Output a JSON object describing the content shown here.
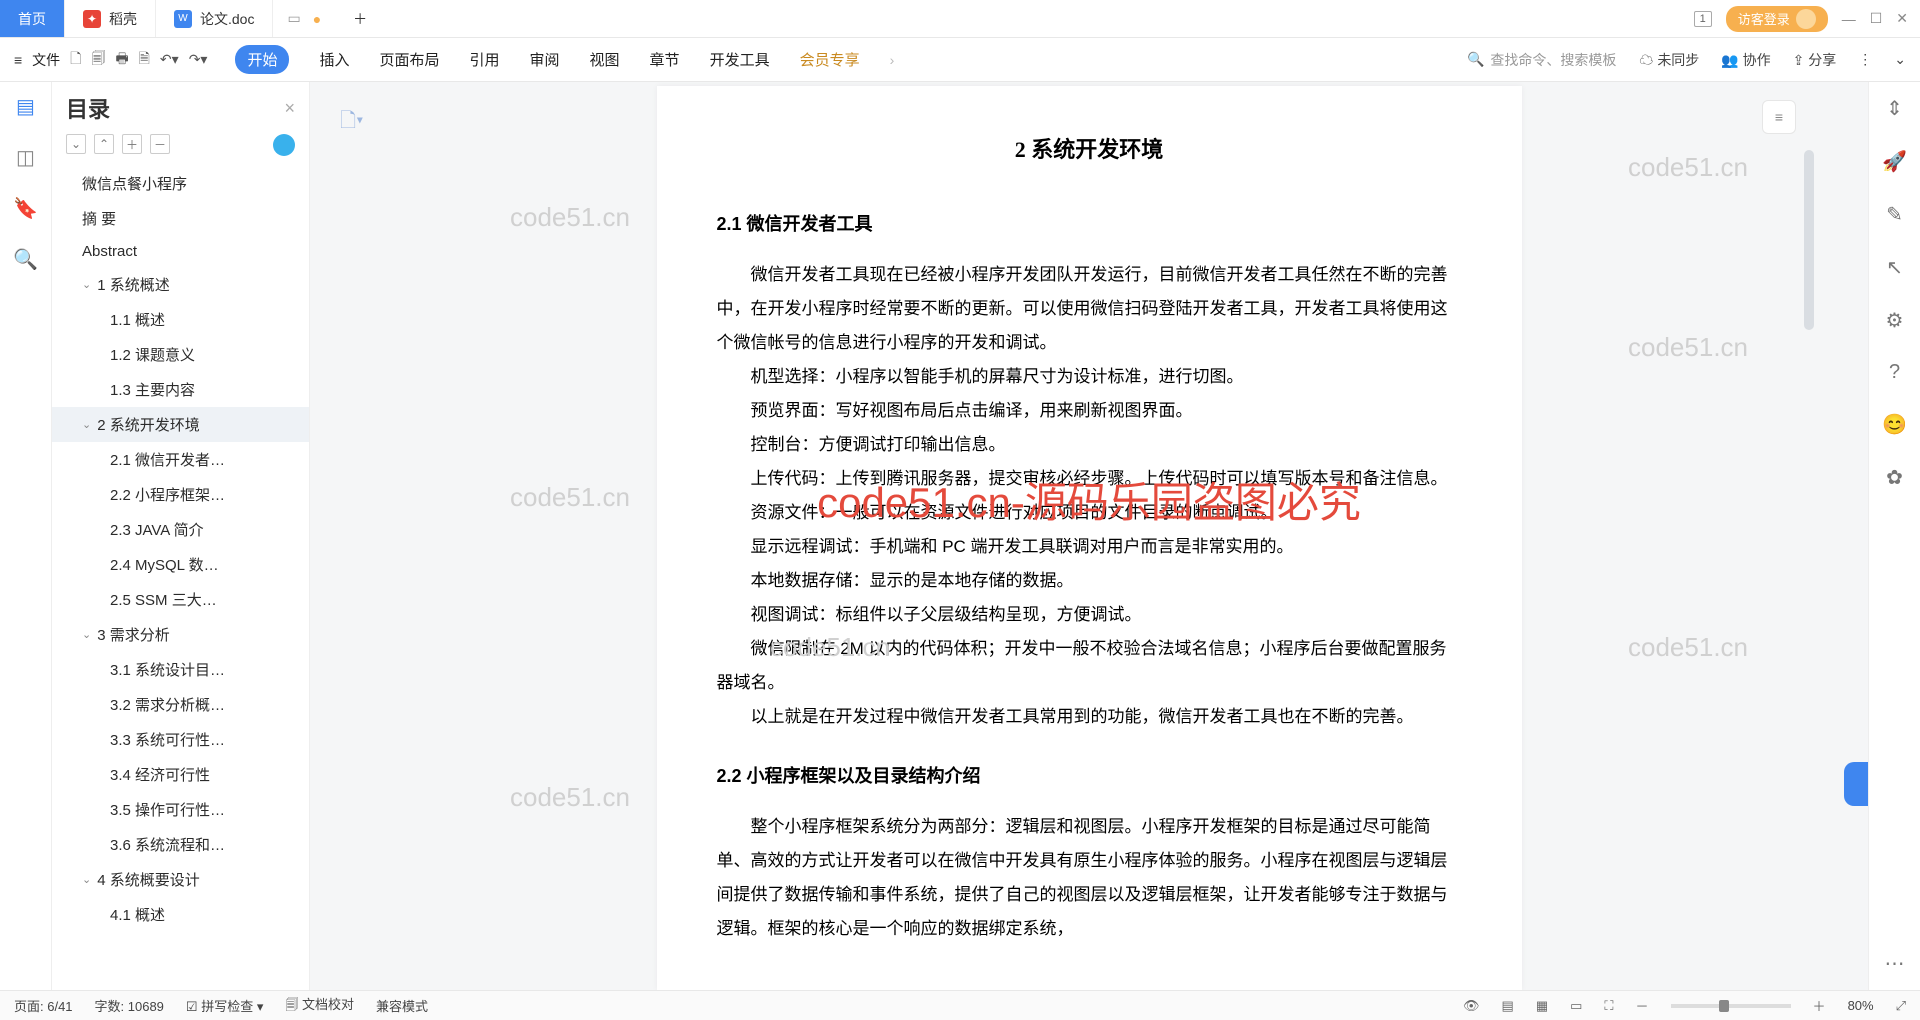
{
  "titlebar": {
    "home": "首页",
    "daoke": "稻壳",
    "doc": "论文.doc",
    "badge": "1",
    "login": "访客登录"
  },
  "ribbon": {
    "menu": "文件",
    "tabs": [
      "开始",
      "插入",
      "页面布局",
      "引用",
      "审阅",
      "视图",
      "章节",
      "开发工具",
      "会员专享"
    ],
    "search_placeholder": "查找命令、搜索模板",
    "sync": "未同步",
    "coop": "协作",
    "share": "分享"
  },
  "toc": {
    "title": "目录",
    "items": [
      {
        "t": "微信点餐小程序",
        "lv": 0
      },
      {
        "t": "摘 要",
        "lv": 0
      },
      {
        "t": "Abstract",
        "lv": 0
      },
      {
        "t": "1 系统概述",
        "lv": 1,
        "caret": true
      },
      {
        "t": "1.1 概述",
        "lv": 2
      },
      {
        "t": "1.2 课题意义",
        "lv": 2
      },
      {
        "t": "1.3 主要内容",
        "lv": 2
      },
      {
        "t": "2 系统开发环境",
        "lv": 1,
        "caret": true,
        "sel": true
      },
      {
        "t": "2.1 微信开发者…",
        "lv": 2
      },
      {
        "t": "2.2 小程序框架…",
        "lv": 2
      },
      {
        "t": "2.3 JAVA 简介",
        "lv": 2
      },
      {
        "t": "2.4 MySQL 数…",
        "lv": 2
      },
      {
        "t": "2.5 SSM 三大…",
        "lv": 2
      },
      {
        "t": "3 需求分析",
        "lv": 1,
        "caret": true
      },
      {
        "t": "3.1 系统设计目…",
        "lv": 2
      },
      {
        "t": "3.2 需求分析概…",
        "lv": 2
      },
      {
        "t": "3.3 系统可行性…",
        "lv": 2
      },
      {
        "t": "3.4 经济可行性",
        "lv": 2
      },
      {
        "t": "3.5 操作可行性…",
        "lv": 2
      },
      {
        "t": "3.6 系统流程和…",
        "lv": 2
      },
      {
        "t": "4 系统概要设计",
        "lv": 1,
        "caret": true
      },
      {
        "t": "4.1 概述",
        "lv": 2
      }
    ]
  },
  "doc": {
    "h1": "2  系统开发环境",
    "h21": "2.1 微信开发者工具",
    "p1": "微信开发者工具现在已经被小程序开发团队开发运行，目前微信开发者工具任然在不断的完善中，在开发小程序时经常要不断的更新。可以使用微信扫码登陆开发者工具，开发者工具将使用这个微信帐号的信息进行小程序的开发和调试。",
    "p2": "机型选择：小程序以智能手机的屏幕尺寸为设计标准，进行切图。",
    "p3": "预览界面：写好视图布局后点击编译，用来刷新视图界面。",
    "p4": "控制台：方便调试打印输出信息。",
    "p5": "上传代码：上传到腾讯服务器，提交审核必经步骤。上传代码时可以填写版本号和备注信息。",
    "p6": "资源文件：一般可以在资源文件进行对应项目的文件目录的断点调试。",
    "p7": "显示远程调试：手机端和 PC 端开发工具联调对用户而言是非常实用的。",
    "p8": "本地数据存储：显示的是本地存储的数据。",
    "p9": "视图调试：标组件以子父层级结构呈现，方便调试。",
    "p10": "微信限制在 2M 以内的代码体积；开发中一般不校验合法域名信息；小程序后台要做配置服务器域名。",
    "p11": "以上就是在开发过程中微信开发者工具常用到的功能，微信开发者工具也在不断的完善。",
    "h22": "2.2 小程序框架以及目录结构介绍",
    "p12": "整个小程序框架系统分为两部分：逻辑层和视图层。小程序开发框架的目标是通过尽可能简单、高效的方式让开发者可以在微信中开发具有原生小程序体验的服务。小程序在视图层与逻辑层间提供了数据传输和事件系统，提供了自己的视图层以及逻辑层框架，让开发者能够专注于数据与逻辑。框架的核心是一个响应的数据绑定系统，"
  },
  "watermark": {
    "small": "code51.cn",
    "big": "code51.cn-源码乐园盗图必究"
  },
  "status": {
    "page": "页面: 6/41",
    "words": "字数: 10689",
    "spell": "拼写检查",
    "proof": "文档校对",
    "compat": "兼容模式",
    "zoom": "80%"
  }
}
